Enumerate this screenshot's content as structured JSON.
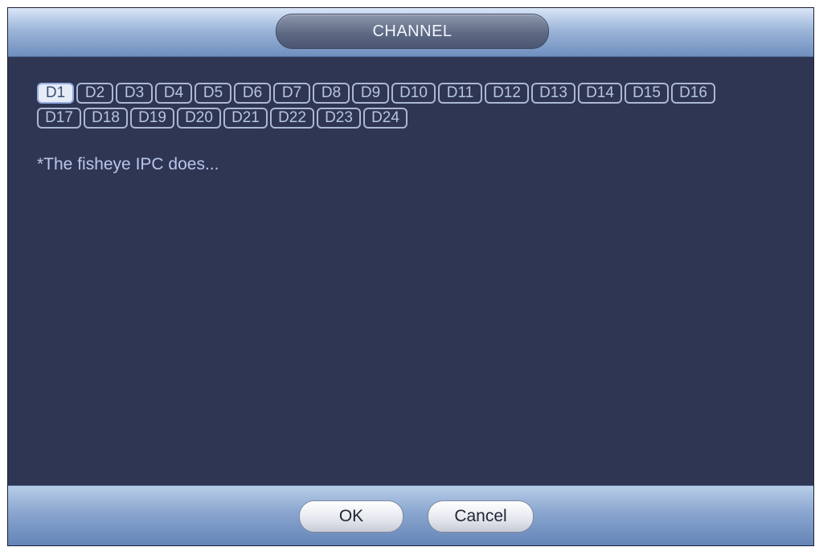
{
  "dialog": {
    "title": "CHANNEL",
    "channels_row1": [
      "D1",
      "D2",
      "D3",
      "D4",
      "D5",
      "D6",
      "D7",
      "D8",
      "D9",
      "D10",
      "D11",
      "D12",
      "D13",
      "D14",
      "D15",
      "D16"
    ],
    "channels_row2": [
      "D17",
      "D18",
      "D19",
      "D20",
      "D21",
      "D22",
      "D23",
      "D24"
    ],
    "selected_channel": "D1",
    "note": "*The fisheye IPC does...",
    "ok_label": "OK",
    "cancel_label": "Cancel"
  },
  "colors": {
    "background": "#2e3653",
    "titlebar": "#9db6d9",
    "channel_outline": "#aab7d6",
    "note_text": "#b9c6ec"
  }
}
